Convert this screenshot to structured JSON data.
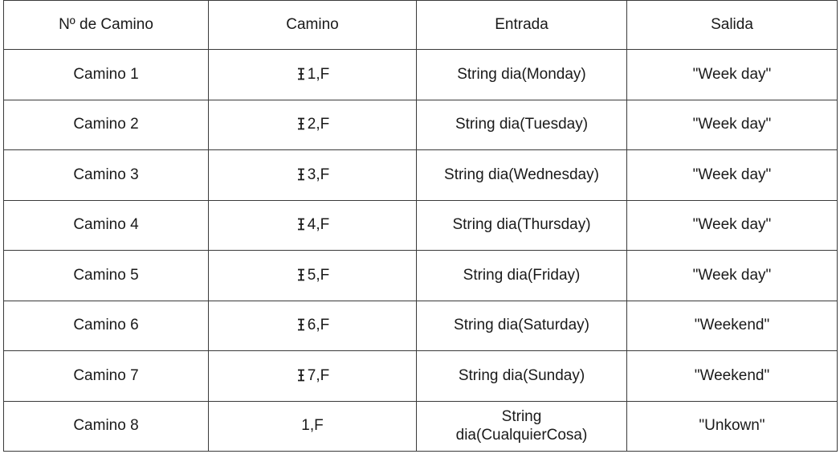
{
  "table": {
    "headers": [
      "Nº de Camino",
      "Camino",
      "Entrada",
      "Salida"
    ],
    "rows": [
      {
        "camino": "Camino 1",
        "path": "1,F",
        "path_glyph": "i-beam-cursor-icon",
        "entrada": "String dia(Monday)",
        "salida": "\"Week day\""
      },
      {
        "camino": "Camino 2",
        "path": "2,F",
        "path_glyph": "i-beam-cursor-icon",
        "entrada": "String dia(Tuesday)",
        "salida": "\"Week day\""
      },
      {
        "camino": "Camino 3",
        "path": "3,F",
        "path_glyph": "i-beam-cursor-icon",
        "entrada": "String dia(Wednesday)",
        "salida": "\"Week day\""
      },
      {
        "camino": "Camino 4",
        "path": "4,F",
        "path_glyph": "i-beam-cursor-icon",
        "entrada": "String dia(Thursday)",
        "salida": "\"Week day\""
      },
      {
        "camino": "Camino 5",
        "path": "5,F",
        "path_glyph": "i-beam-cursor-icon",
        "entrada": "String dia(Friday)",
        "salida": "\"Week day\""
      },
      {
        "camino": "Camino 6",
        "path": "6,F",
        "path_glyph": "i-beam-cursor-icon",
        "entrada": "String dia(Saturday)",
        "salida": "\"Weekend\""
      },
      {
        "camino": "Camino 7",
        "path": "7,F",
        "path_glyph": "i-beam-cursor-icon",
        "entrada": "String dia(Sunday)",
        "salida": "\"Weekend\""
      },
      {
        "camino": "Camino 8",
        "path": "1,F",
        "path_glyph": "",
        "entrada_line1": "String",
        "entrada_line2": "dia(CualquierCosa)",
        "salida": "\"Unkown\""
      }
    ]
  },
  "colors": {
    "border": "#3a3a3a",
    "text": "#1a1a1a",
    "background": "#ffffff"
  }
}
